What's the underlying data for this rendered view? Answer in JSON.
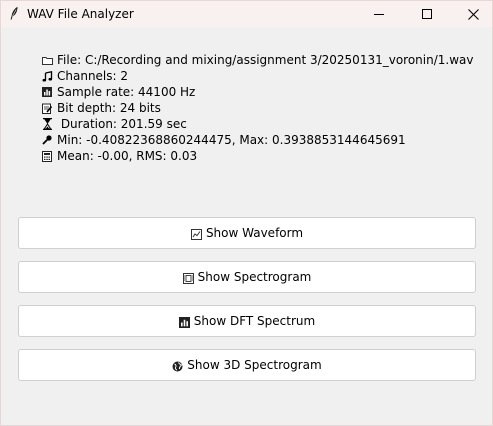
{
  "window": {
    "title": "WAV File Analyzer",
    "icons": {
      "app": "feather-icon",
      "minimize": "minimize-icon",
      "maximize": "maximize-icon",
      "close": "close-icon"
    }
  },
  "info": {
    "lines": [
      {
        "icon": "folder-icon",
        "text": "File: C:/Recording and mixing/assignment 3/20250131_voronin/1.wav"
      },
      {
        "icon": "music-note-icon",
        "text": "Channels: 2"
      },
      {
        "icon": "bar-chart-icon",
        "text": "Sample rate: 44100 Hz"
      },
      {
        "icon": "memo-icon",
        "text": "Bit depth: 24 bits"
      },
      {
        "icon": "hourglass-icon",
        "text": " Duration: 201.59 sec"
      },
      {
        "icon": "microphone-icon",
        "text": "Min: -0.40822368860244475, Max: 0.3938853144645691"
      },
      {
        "icon": "calculator-icon",
        "text": "Mean: -0.00, RMS: 0.03"
      }
    ]
  },
  "buttons": {
    "waveform": {
      "icon": "chart-icon",
      "label": "Show Waveform"
    },
    "spectrogram": {
      "icon": "film-frame-icon",
      "label": "Show Spectrogram"
    },
    "dft": {
      "icon": "bar-chart-icon",
      "label": "Show DFT Spectrum"
    },
    "spectrogram3d": {
      "icon": "globe-icon",
      "label": "Show 3D Spectrogram"
    }
  }
}
